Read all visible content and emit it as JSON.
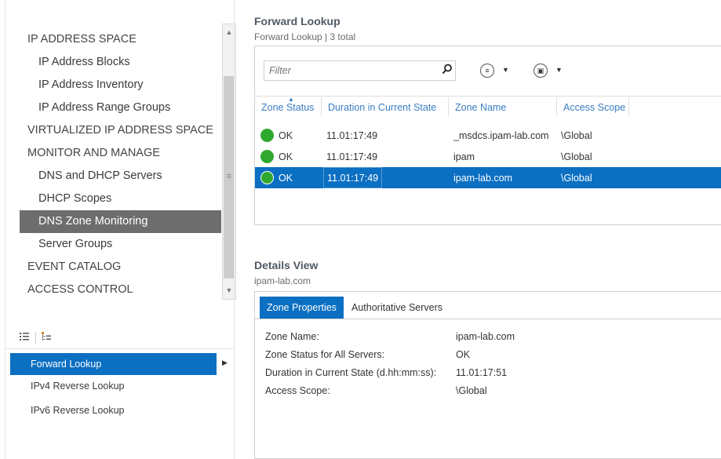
{
  "nav": {
    "items": [
      {
        "label": "IP ADDRESS SPACE",
        "level": "top"
      },
      {
        "label": "IP Address Blocks",
        "level": "sub"
      },
      {
        "label": "IP Address Inventory",
        "level": "sub"
      },
      {
        "label": "IP Address Range Groups",
        "level": "sub"
      },
      {
        "label": "VIRTUALIZED IP ADDRESS SPACE",
        "level": "top"
      },
      {
        "label": "MONITOR AND MANAGE",
        "level": "top"
      },
      {
        "label": "DNS and DHCP Servers",
        "level": "sub"
      },
      {
        "label": "DHCP Scopes",
        "level": "sub"
      },
      {
        "label": "DNS Zone Monitoring",
        "level": "sub",
        "selected": true
      },
      {
        "label": "Server Groups",
        "level": "sub"
      },
      {
        "label": "EVENT CATALOG",
        "level": "top"
      },
      {
        "label": "ACCESS CONTROL",
        "level": "top"
      }
    ],
    "scroll_up_icon": "▲",
    "scroll_down_icon": "▼",
    "scroll_grip": "≡"
  },
  "view_toggle": {
    "list_icon": "list-view-icon",
    "tree_icon": "tree-view-icon"
  },
  "lookup_list": {
    "items": [
      {
        "label": "Forward Lookup",
        "selected": true
      },
      {
        "label": "IPv4 Reverse Lookup"
      },
      {
        "label": "IPv6 Reverse Lookup"
      }
    ]
  },
  "forward": {
    "title": "Forward Lookup",
    "subtitle": "Forward Lookup | 3 total",
    "filter_placeholder": "Filter",
    "columns": [
      "Zone Status",
      "Duration in Current State",
      "Zone Name",
      "Access Scope"
    ],
    "rows": [
      {
        "status": "OK",
        "duration": "11.01:17:49",
        "zone": "_msdcs.ipam-lab.com",
        "scope": "\\Global",
        "status_color": "#2fa82f"
      },
      {
        "status": "OK",
        "duration": "11.01:17:49",
        "zone": "ipam",
        "scope": "\\Global",
        "status_color": "#2fa82f"
      },
      {
        "status": "OK",
        "duration": "11.01:17:49",
        "zone": "ipam-lab.com",
        "scope": "\\Global",
        "status_color": "#2fa82f",
        "selected": true
      }
    ]
  },
  "details": {
    "title": "Details View",
    "subtitle": "ipam-lab.com",
    "tabs": [
      "Zone Properties",
      "Authoritative Servers"
    ],
    "properties": [
      {
        "label": "Zone Name:",
        "value": "ipam-lab.com"
      },
      {
        "label": "Zone Status for All Servers:",
        "value": "OK"
      },
      {
        "label": "Duration in Current State (d.hh:mm:ss):",
        "value": "11.01:17:51"
      },
      {
        "label": "Access Scope:",
        "value": "\\Global"
      }
    ]
  },
  "colors": {
    "selection": "#0b6fc2",
    "nav_selected": "#6d6d6d",
    "header_text": "#3a7ec3",
    "status_ok": "#2fa82f"
  }
}
